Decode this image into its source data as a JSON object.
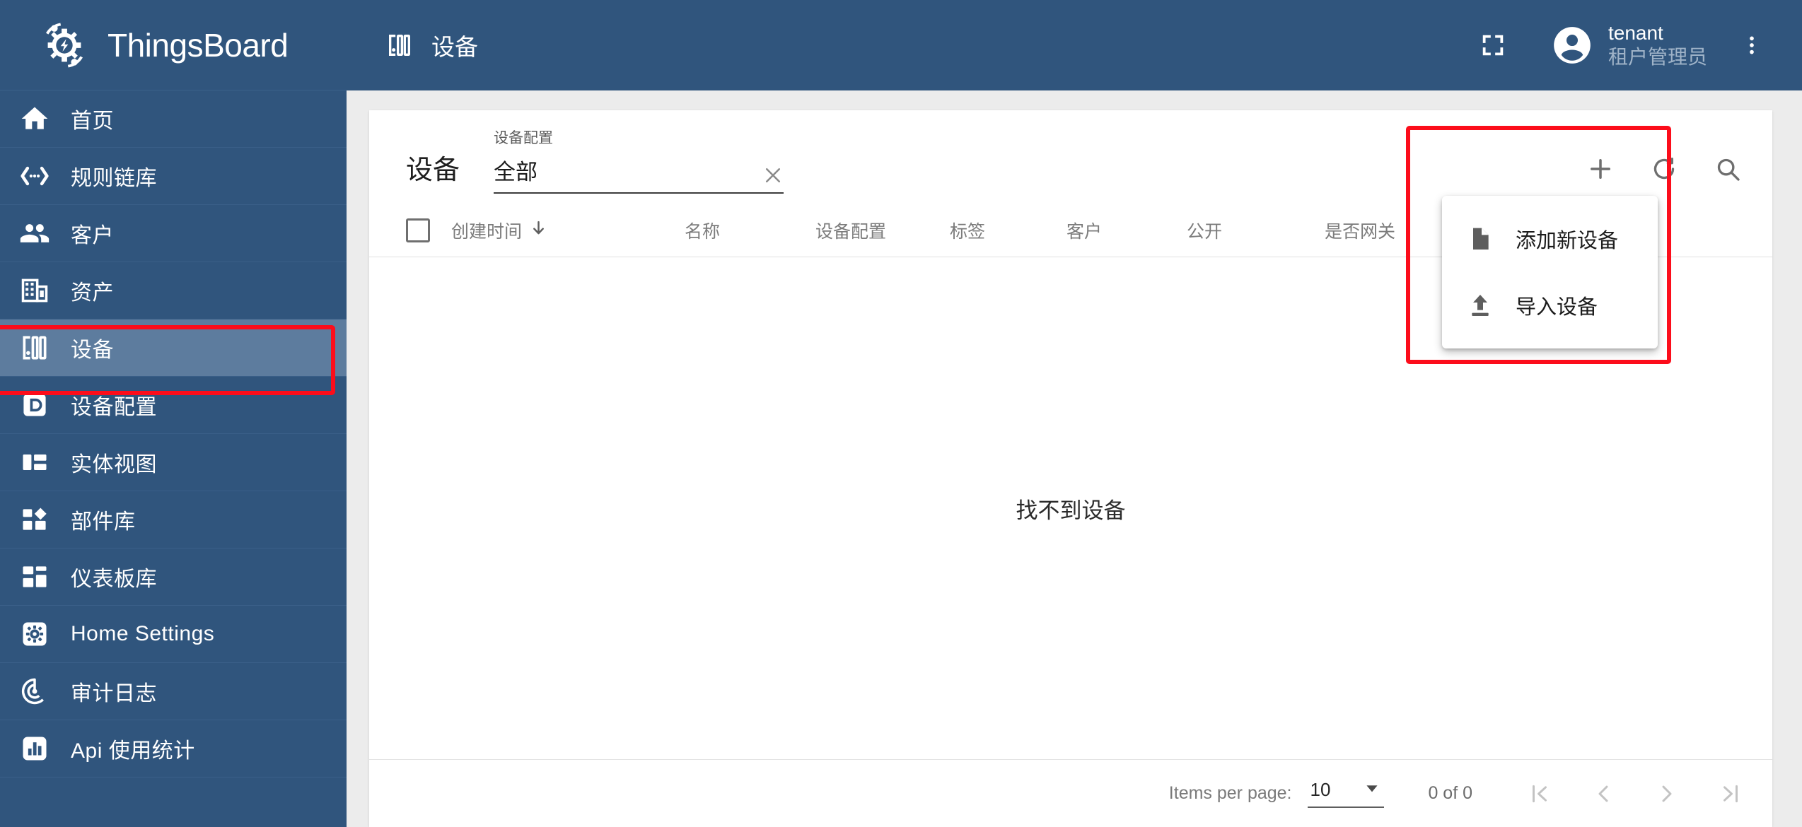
{
  "brand": {
    "name": "ThingsBoard",
    "logo_icon": "thingsboard-logo-icon"
  },
  "sidebar": {
    "items": [
      {
        "label": "首页",
        "icon": "home-icon",
        "key": "home",
        "active": false
      },
      {
        "label": "规则链库",
        "icon": "rule-chain-icon",
        "key": "rule-chains",
        "active": false
      },
      {
        "label": "客户",
        "icon": "customers-icon",
        "key": "customers",
        "active": false
      },
      {
        "label": "资产",
        "icon": "assets-icon",
        "key": "assets",
        "active": false
      },
      {
        "label": "设备",
        "icon": "devices-icon",
        "key": "devices",
        "active": true
      },
      {
        "label": "设备配置",
        "icon": "device-profiles-icon",
        "key": "device-profiles",
        "active": false
      },
      {
        "label": "实体视图",
        "icon": "entity-views-icon",
        "key": "entity-views",
        "active": false
      },
      {
        "label": "部件库",
        "icon": "widgets-icon",
        "key": "widgets-library",
        "active": false
      },
      {
        "label": "仪表板库",
        "icon": "dashboards-icon",
        "key": "dashboards",
        "active": false
      },
      {
        "label": "Home Settings",
        "icon": "home-settings-icon",
        "key": "home-settings",
        "active": false
      },
      {
        "label": "审计日志",
        "icon": "audit-logs-icon",
        "key": "audit-logs",
        "active": false
      },
      {
        "label": "Api 使用统计",
        "icon": "api-usage-icon",
        "key": "api-usage",
        "active": false
      }
    ]
  },
  "topbar": {
    "page_icon": "devices-icon",
    "page_title": "设备",
    "fullscreen_icon": "fullscreen-icon",
    "avatar_icon": "account-circle-icon",
    "user_name": "tenant",
    "user_role": "租户管理员",
    "more_icon": "more-vertical-icon"
  },
  "card": {
    "title": "设备",
    "filter": {
      "label": "设备配置",
      "value": "全部",
      "clear_icon": "close-icon"
    },
    "actions": [
      {
        "icon": "plus-icon",
        "name": "add-device-button"
      },
      {
        "icon": "refresh-icon",
        "name": "refresh-button"
      },
      {
        "icon": "search-icon",
        "name": "search-button"
      }
    ],
    "columns": [
      {
        "label": "创建时间",
        "sort_icon": "arrow-down-icon",
        "key": "created-time"
      },
      {
        "label": "名称",
        "key": "name"
      },
      {
        "label": "设备配置",
        "key": "device-profile"
      },
      {
        "label": "标签",
        "key": "label"
      },
      {
        "label": "客户",
        "key": "customer"
      },
      {
        "label": "公开",
        "key": "public"
      },
      {
        "label": "是否网关",
        "key": "is-gateway"
      }
    ],
    "empty_message": "找不到设备",
    "footer": {
      "items_per_page_label": "Items per page:",
      "items_per_page_value": "10",
      "dropdown_icon": "caret-down-icon",
      "range_label": "0 of 0",
      "pager": [
        {
          "icon": "first-page-icon",
          "name": "first-page-button"
        },
        {
          "icon": "previous-page-icon",
          "name": "previous-page-button"
        },
        {
          "icon": "next-page-icon",
          "name": "next-page-button"
        },
        {
          "icon": "last-page-icon",
          "name": "last-page-button"
        }
      ]
    }
  },
  "context_menu": {
    "items": [
      {
        "label": "添加新设备",
        "icon": "file-icon",
        "key": "add-new-device"
      },
      {
        "label": "导入设备",
        "icon": "upload-icon",
        "key": "import-device"
      }
    ]
  },
  "annotations": {
    "color": "#fc0d1b",
    "highlights": [
      "sidebar-item-devices",
      "add-device-menu"
    ]
  }
}
